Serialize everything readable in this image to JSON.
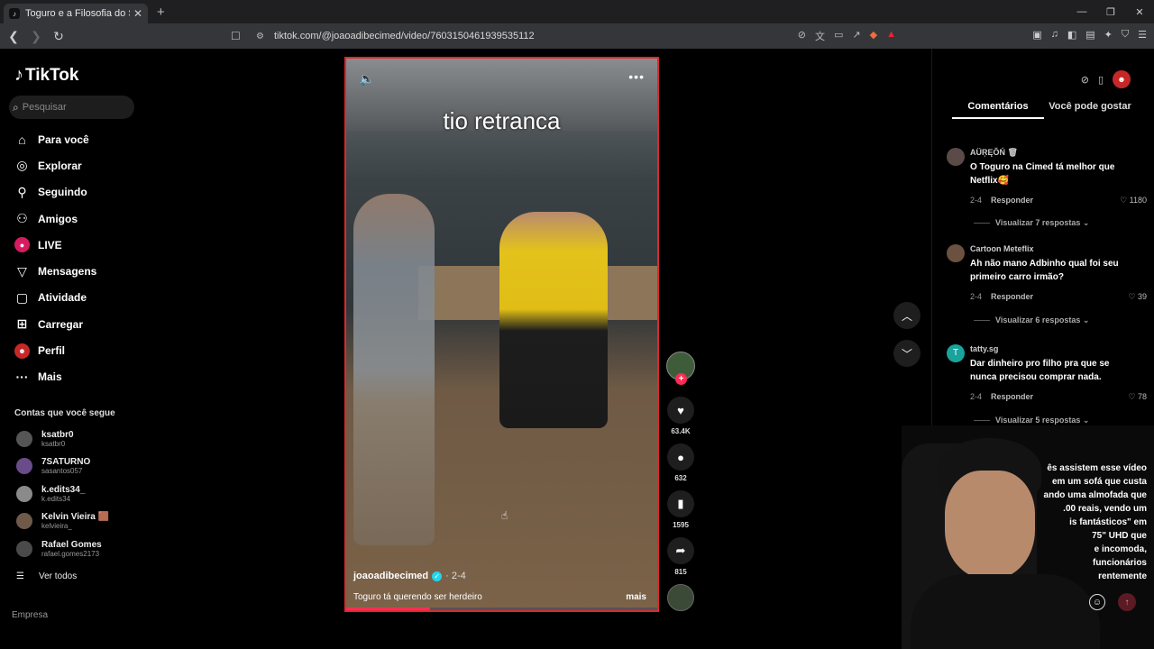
{
  "browser": {
    "tab_title": "Toguro e a Filosofia do Sucesso",
    "tab_close": "✕",
    "new_tab": "+",
    "url": "tiktok.com/@joaoadibecimed/video/7603150461939535112"
  },
  "sidebar": {
    "logo": "TikTok",
    "search_placeholder": "Pesquisar",
    "menu": [
      {
        "label": "Para você",
        "icon": "home-icon"
      },
      {
        "label": "Explorar",
        "icon": "compass-icon"
      },
      {
        "label": "Seguindo",
        "icon": "following-icon"
      },
      {
        "label": "Amigos",
        "icon": "friends-icon"
      },
      {
        "label": "LIVE",
        "icon": "live-icon"
      },
      {
        "label": "Mensagens",
        "icon": "messages-icon"
      },
      {
        "label": "Atividade",
        "icon": "activity-icon"
      },
      {
        "label": "Carregar",
        "icon": "upload-icon"
      },
      {
        "label": "Perfil",
        "icon": "profile-icon"
      },
      {
        "label": "Mais",
        "icon": "more-icon"
      }
    ],
    "following_header": "Contas que você segue",
    "accounts": [
      {
        "name": "ksatbr0",
        "user": "ksatbr0"
      },
      {
        "name": "7SATURNO",
        "user": "sasantos057"
      },
      {
        "name": "k.edits34_",
        "user": "k.edits34"
      },
      {
        "name": "Kelvin Vieira 🟫",
        "user": "kelvieira_"
      },
      {
        "name": "Rafael Gomes",
        "user": "rafael.gomes2173"
      }
    ],
    "see_all": "Ver todos",
    "footer": "Empresa"
  },
  "video": {
    "caption_overlay": "tio retranca",
    "author": "joaoadibecimed",
    "date": "· 2-4",
    "description": "Toguro tá querendo ser herdeiro",
    "more": "mais",
    "progress": 0.27
  },
  "actions": {
    "likes": "63.4K",
    "comments": "632",
    "saves": "1595",
    "shares": "815"
  },
  "comments_panel": {
    "tabs": [
      "Comentários",
      "Você pode gostar"
    ],
    "comments": [
      {
        "user": "AÜŖĘŎŃ 🗑",
        "text": "O Toguro na Cimed tá melhor que Netflix🥰",
        "date": "2-4",
        "reply": "Responder",
        "likes": "1180",
        "view_replies": "Visualizar 7 respostas ⌄",
        "avatar_color": "#5a4a48"
      },
      {
        "user": "Cartoon Meteflix",
        "text": "Ah não mano Adbinho qual foi seu primeiro carro irmão?",
        "date": "2-4",
        "reply": "Responder",
        "likes": "39",
        "view_replies": "Visualizar 6 respostas ⌄",
        "avatar_color": "#6b5140"
      },
      {
        "user": "tatty.sg",
        "text": "Dar dinheiro pro filho pra que se nunca precisou comprar nada.",
        "date": "2-4",
        "reply": "Responder",
        "likes": "78",
        "view_replies": "Visualizar 5 respostas ⌄",
        "avatar_color": "#1aa39b",
        "initial": "T"
      }
    ],
    "overlay_text": "ês assistem esse vídeo\nem um sofá que custa\nando uma almofada que\n.00 reais, vendo um\nis fantásticos\" em\n75\" UHD que\ne incomoda,\nfuncionários\nrentemente"
  },
  "colors": {
    "accent": "#fe2c55",
    "video_border": "#e0272f",
    "verified": "#20d5ec"
  }
}
